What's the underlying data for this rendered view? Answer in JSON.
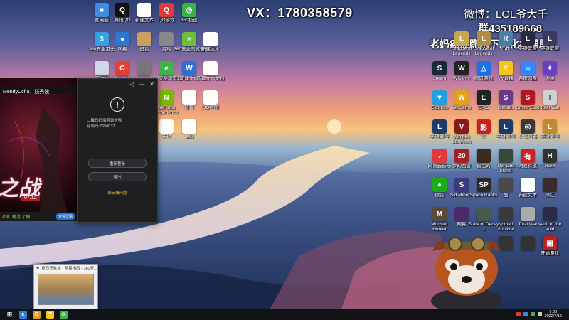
{
  "overlay": {
    "vx": "VX：1780358579",
    "weibo": "微博：LOL爷大千",
    "group": "群435189668",
    "plea": "老妈癌症跪求下次化疗帮助"
  },
  "desktop_icons_left": [
    {
      "label": "此电脑",
      "color": "#3d8ee0",
      "glyph": "■"
    },
    {
      "label": "腾讯QQ",
      "color": "#111111",
      "glyph": "Q"
    },
    {
      "label": "新建文本",
      "color": "#ffffff",
      "glyph": ""
    },
    {
      "label": "QQ游戏",
      "color": "#e23a3a",
      "glyph": "Q"
    },
    {
      "label": "360极速",
      "color": "#3bb34a",
      "glyph": "◎"
    },
    {
      "label": "360安全卫士",
      "color": "#35a0e6",
      "glyph": "3"
    },
    {
      "label": "网络",
      "color": "#2e78d0",
      "glyph": "●"
    },
    {
      "label": "迅雷",
      "color": "#c9a060",
      "glyph": ""
    },
    {
      "label": "游戏",
      "color": "#888888",
      "glyph": ""
    },
    {
      "label": "360安全浏览器",
      "color": "#6bbf3b",
      "glyph": "e"
    },
    {
      "label": "新建文本",
      "color": "#ffffff",
      "glyph": ""
    },
    {
      "label": "回收站",
      "color": "#cfd8e6",
      "glyph": ""
    },
    {
      "label": "Google",
      "color": "#e34133",
      "glyph": "G"
    },
    {
      "label": "",
      "color": "#777777",
      "glyph": ""
    },
    {
      "label": "360安全浏览器",
      "color": "#3db34a",
      "glyph": "e"
    },
    {
      "label": "新建文本",
      "color": "#2f6fd6",
      "glyph": "W"
    },
    {
      "label": "新建文本文档",
      "color": "#ffffff",
      "glyph": ""
    },
    {
      "label": "GeForce Experience",
      "color": "#76b900",
      "glyph": "N"
    },
    {
      "label": "新建",
      "color": "#ffffff",
      "glyph": ""
    },
    {
      "label": "QQ截图",
      "color": "#ffffff",
      "glyph": ""
    },
    {
      "label": "新建",
      "color": "#ffffff",
      "glyph": ""
    },
    {
      "label": "IMG",
      "color": "#ffffff",
      "glyph": ""
    }
  ],
  "desktop_icons_right": [
    {
      "label": "League of Legends",
      "color": "#c8a84a",
      "glyph": "L"
    },
    {
      "label": "League of Legends",
      "color": "#b09040",
      "glyph": "L"
    },
    {
      "label": "Raft",
      "color": "#4a7fa8",
      "glyph": "R"
    },
    {
      "label": "英雄联盟",
      "color": "#2a2a40",
      "glyph": "L"
    },
    {
      "label": "英雄联盟",
      "color": "#3a3a60",
      "glyph": "L"
    },
    {
      "label": "Steam",
      "color": "#1b2838",
      "glyph": "S"
    },
    {
      "label": "WGame",
      "color": "#222222",
      "glyph": "W"
    },
    {
      "label": "腾讯游戏",
      "color": "#1a73e8",
      "glyph": "△"
    },
    {
      "label": "YY直播",
      "color": "#f5c518",
      "glyph": "Y"
    },
    {
      "label": "百度网盘",
      "color": "#3388ff",
      "glyph": "∞"
    },
    {
      "label": "火绒",
      "color": "#6a3fc8",
      "glyph": "✦"
    },
    {
      "label": "Express",
      "color": "#22a0e0",
      "glyph": "♥"
    },
    {
      "label": "WeGame",
      "color": "#e0a020",
      "glyph": "W"
    },
    {
      "label": "EPIC",
      "color": "#222222",
      "glyph": "E"
    },
    {
      "label": "Stellaris",
      "color": "#6a3a8a",
      "glyph": "S"
    },
    {
      "label": "Sniper Elite",
      "color": "#b01820",
      "glyph": "S"
    },
    {
      "label": "Total War",
      "color": "#d0d0d0",
      "glyph": "T"
    },
    {
      "label": "英雄联盟",
      "color": "#1e3a6a",
      "glyph": "L"
    },
    {
      "label": "Vampire Survivors",
      "color": "#8a1a1a",
      "glyph": "V"
    },
    {
      "label": "影",
      "color": "#cc2020",
      "glyph": "影"
    },
    {
      "label": "英雄联盟",
      "color": "#1e3a6a",
      "glyph": "L"
    },
    {
      "label": "火影忍者",
      "color": "#3a3a3a",
      "glyph": "◎"
    },
    {
      "label": "英雄联盟",
      "color": "#c08a30",
      "glyph": "L"
    },
    {
      "label": "网易云音乐",
      "color": "#e13a3a",
      "glyph": "♪"
    },
    {
      "label": "梦幻西游",
      "color": "#a82020",
      "glyph": "20"
    },
    {
      "label": "最后的",
      "color": "#3a2a1a",
      "glyph": ""
    },
    {
      "label": "The Last Stand",
      "color": "#3a4a3a",
      "glyph": ""
    },
    {
      "label": "网易有道",
      "color": "#d02020",
      "glyph": "有"
    },
    {
      "label": "Hard",
      "color": "#333333",
      "glyph": "H"
    },
    {
      "label": "微信",
      "color": "#1aad19",
      "glyph": "●"
    },
    {
      "label": "Sid Meier's",
      "color": "#3a3a80",
      "glyph": "S"
    },
    {
      "label": "Space Ranks",
      "color": "#2a2a2a",
      "glyph": "SP"
    },
    {
      "label": "战",
      "color": "#4a4a4a",
      "glyph": ""
    },
    {
      "label": "新建文本",
      "color": "#ffffff",
      "glyph": ""
    },
    {
      "label": "绿红",
      "color": "#3a2a2a",
      "glyph": ""
    },
    {
      "label": "Monster Hunter",
      "color": "#5a4a3a",
      "glyph": "M"
    },
    {
      "label": "网易",
      "color": "#4a2a6a",
      "glyph": ""
    },
    {
      "label": "State of Decay 2",
      "color": "#4a5a4a",
      "glyph": ""
    },
    {
      "label": "Nomad Survival",
      "color": "#3a3a3a",
      "glyph": ""
    },
    {
      "label": "Total War",
      "color": "#aaaaaa",
      "glyph": ""
    },
    {
      "label": "Vault of the Void",
      "color": "#2a2a4a",
      "glyph": ""
    },
    {
      "label": "",
      "color": "#333333",
      "glyph": ""
    },
    {
      "label": "",
      "color": "#333333",
      "glyph": ""
    },
    {
      "label": "精灵",
      "color": "#3a6a3a",
      "glyph": ""
    },
    {
      "label": "",
      "color": "#444444",
      "glyph": ""
    },
    {
      "label": "开始游戏",
      "color": "#c02020",
      "glyph": "▣"
    }
  ],
  "login_dialog": {
    "minimize": "—",
    "close": "✕",
    "sound": "◁",
    "alert_glyph": "!",
    "message_line1": "二维码扫描登录失败",
    "message_line2": "错误码:7650032",
    "relogin_button": "重新登录",
    "exit_button": "退出",
    "help_link": "去反馈问题"
  },
  "game_banner": {
    "player_name": "MendyCcha：妖秀波",
    "big_text": "之战",
    "date_badge": "07.12",
    "footer_left": "小A",
    "footer_mid": "瞳凌 了解",
    "footer_btn": "查看详情"
  },
  "taskbar_preview": {
    "caption": "夏日狂欢派 - 网易棋战 - 360安...",
    "icon": "◆"
  },
  "taskbar": {
    "start_icon": "⊞",
    "apps": [
      {
        "name": "edge",
        "color": "#2a7fd6",
        "glyph": "e"
      },
      {
        "name": "wegame",
        "color": "#e0a020",
        "glyph": "G"
      },
      {
        "name": "yy",
        "color": "#f5c518",
        "glyph": "Y"
      },
      {
        "name": "360",
        "color": "#3bb34a",
        "glyph": "◎"
      }
    ],
    "time": "9:00",
    "date": "2022/7/16"
  },
  "colors": {
    "accent": "#2b6fd1",
    "dialog_bg": "#1f1f22",
    "link": "#f0c060"
  }
}
